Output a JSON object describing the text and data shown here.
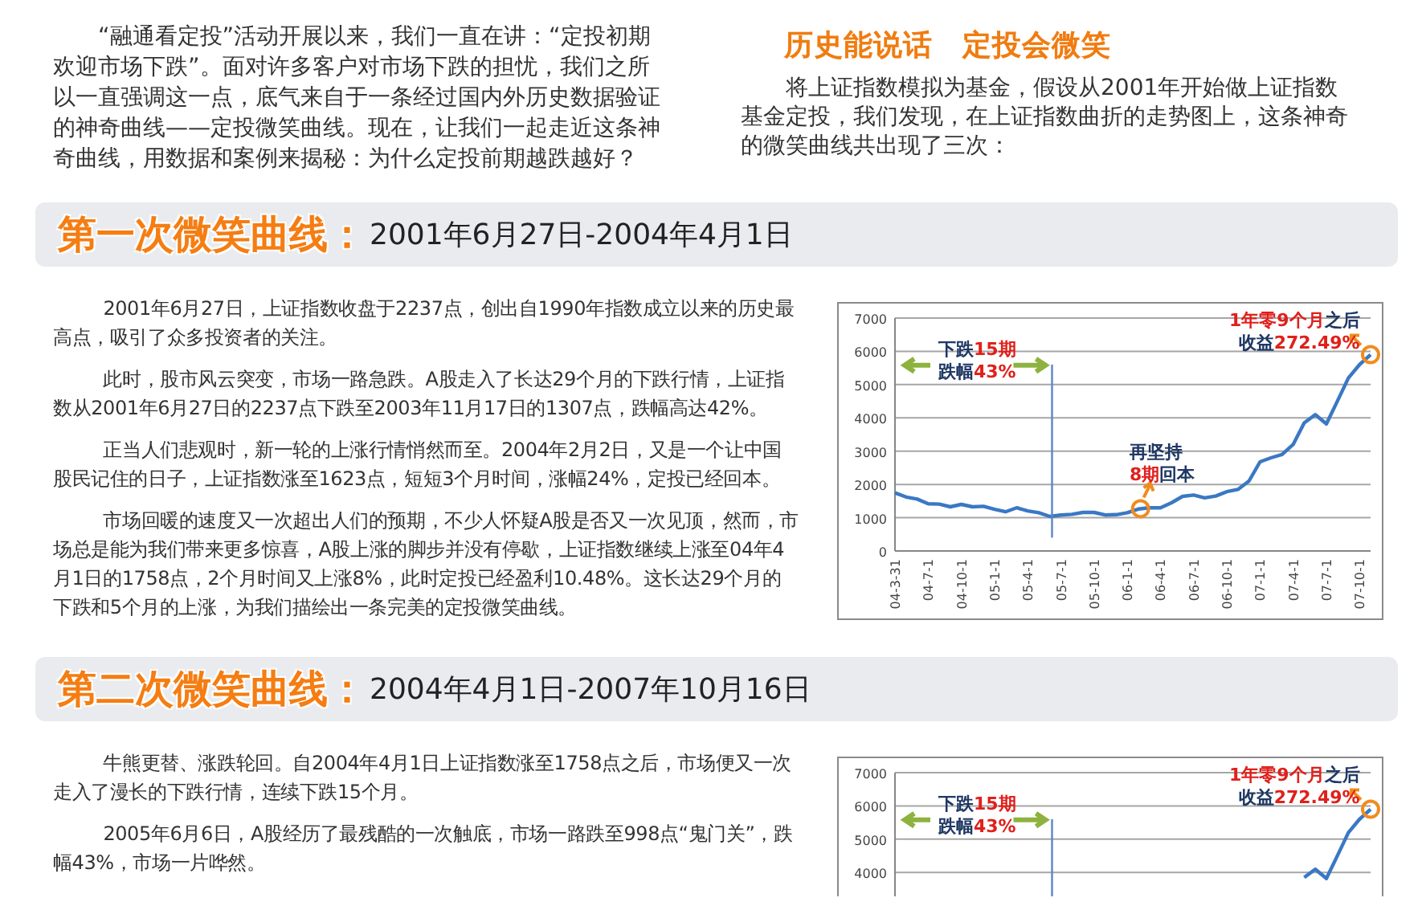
{
  "intro": {
    "paragraph": "“融通看定投”活动开展以来，我们一直在讲：“定投初期欢迎市场下跌”。面对许多客户对市场下跌的担忧，我们之所以一直强调这一点，底气来自于一条经过国内外历史数据验证的神奇曲线——定投微笑曲线。现在，让我们一起走近这条神奇曲线，用数据和案例来揭秘：为什么定投前期越跌越好？"
  },
  "aside": {
    "heading": "历史能说话　定投会微笑",
    "paragraph": "将上证指数模拟为基金，假设从2001年开始做上证指数基金定投，我们发现，在上证指数曲折的走势图上，这条神奇的微笑曲线共出现了三次："
  },
  "sections": [
    {
      "title": "第一次微笑曲线：",
      "date_range": "2001年6月27日-2004年4月1日",
      "paragraphs": [
        "2001年6月27日，上证指数收盘于2237点，创出自1990年指数成立以来的历史最高点，吸引了众多投资者的关注。",
        "此时，股市风云突变，市场一路急跌。A股走入了长达29个月的下跌行情，上证指数从2001年6月27日的2237点下跌至2003年11月17日的1307点，跌幅高达42%。",
        "正当人们悲观时，新一轮的上涨行情悄然而至。2004年2月2日，又是一个让中国股民记住的日子，上证指数涨至1623点，短短3个月时间，涨幅24%，定投已经回本。",
        "市场回暖的速度又一次超出人们的预期，不少人怀疑A股是否又一次见顶，然而，市场总是能为我们带来更多惊喜，A股上涨的脚步并没有停歇，上证指数继续上涨至04年4月1日的1758点，2个月时间又上涨8%，此时定投已经盈利10.48%。这长达29个月的下跌和5个月的上涨，为我们描绘出一条完美的定投微笑曲线。"
      ],
      "chart_data": {
        "type": "line",
        "grid": true,
        "ylim": [
          0,
          7000
        ],
        "yticks": [
          0,
          1000,
          2000,
          3000,
          4000,
          5000,
          6000,
          7000
        ],
        "categories": [
          "04-3-31",
          null,
          null,
          "04-7-1",
          null,
          null,
          "04-10-1",
          null,
          null,
          "05-1-1",
          null,
          null,
          "05-4-1",
          null,
          null,
          "05-7-1",
          null,
          null,
          "05-10-1",
          null,
          null,
          "06-1-1",
          null,
          null,
          "06-4-1",
          null,
          null,
          "06-7-1",
          null,
          null,
          "06-10-1",
          null,
          null,
          "07-1-1",
          null,
          null,
          "07-4-1",
          null,
          null,
          "07-7-1",
          null,
          null,
          "07-10-1",
          null
        ],
        "series": [
          {
            "color": "#3a78c4",
            "values": [
              1750,
              1620,
              1560,
              1420,
              1410,
              1330,
              1400,
              1330,
              1340,
              1250,
              1180,
              1300,
              1200,
              1150,
              1040,
              1080,
              1100,
              1160,
              1160,
              1080,
              1090,
              1150,
              1260,
              1300,
              1300,
              1450,
              1640,
              1680,
              1600,
              1650,
              1780,
              1850,
              2100,
              2680,
              2800,
              2900,
              3200,
              3850,
              4100,
              3820,
              4500,
              5200,
              5600,
              5900
            ]
          }
        ]
      },
      "chart_labels": [
        {
          "kind": "drop",
          "lines": [
            [
              {
                "text": "下跌",
                "highlight": false
              },
              {
                "text": "15期",
                "highlight": true
              }
            ],
            [
              {
                "text": "跌幅",
                "highlight": false
              },
              {
                "text": "43%",
                "highlight": true
              }
            ]
          ]
        },
        {
          "kind": "recovery",
          "lines": [
            [
              {
                "text": "再坚持",
                "highlight": false
              }
            ],
            [
              {
                "text": "8期",
                "highlight": true
              },
              {
                "text": "回本",
                "highlight": false
              }
            ]
          ]
        },
        {
          "kind": "gain",
          "lines": [
            [
              {
                "text": "1年零9个月",
                "highlight": true
              },
              {
                "text": "之后",
                "highlight": false
              }
            ],
            [
              {
                "text": "收益",
                "highlight": false
              },
              {
                "text": "272.49%",
                "highlight": true
              }
            ]
          ]
        }
      ]
    },
    {
      "title": "第二次微笑曲线：",
      "date_range": "2004年4月1日-2007年10月16日",
      "paragraphs": [
        "牛熊更替、涨跌轮回。自2004年4月1日上证指数涨至1758点之后，市场便又一次走入了漫长的下跌行情，连续下跌15个月。",
        "2005年6月6日，A股经历了最残酷的一次触底，市场一路跌至998点“鬼门关”，跌幅43%，市场一片哗然。"
      ],
      "chart_data": {
        "type": "line",
        "grid": true,
        "ylim": [
          0,
          7000
        ],
        "yticks": [
          4000,
          5000,
          6000,
          7000
        ],
        "categories": [
          null,
          null,
          null,
          null,
          null,
          null,
          null,
          null,
          null,
          null,
          null,
          null,
          null,
          null,
          null,
          null,
          null,
          null,
          null,
          null,
          null,
          null,
          null,
          null,
          null,
          null,
          null,
          null,
          null,
          null,
          null,
          null,
          null,
          null,
          null,
          null,
          null,
          null,
          null,
          null,
          null,
          null,
          null,
          null
        ],
        "series": [
          {
            "color": "#3a78c4",
            "values": [
              null,
              null,
              null,
              null,
              null,
              null,
              null,
              null,
              null,
              null,
              null,
              null,
              null,
              null,
              null,
              null,
              null,
              null,
              null,
              null,
              null,
              null,
              null,
              null,
              null,
              null,
              null,
              null,
              null,
              null,
              null,
              null,
              null,
              null,
              null,
              null,
              null,
              3850,
              4100,
              3820,
              4500,
              5200,
              5600,
              5900
            ]
          }
        ]
      },
      "chart_labels": [
        {
          "kind": "drop",
          "lines": [
            [
              {
                "text": "下跌",
                "highlight": false
              },
              {
                "text": "15期",
                "highlight": true
              }
            ],
            [
              {
                "text": "跌幅",
                "highlight": false
              },
              {
                "text": "43%",
                "highlight": true
              }
            ]
          ]
        },
        {
          "kind": "gain",
          "lines": [
            [
              {
                "text": "1年零9个月",
                "highlight": true
              },
              {
                "text": "之后",
                "highlight": false
              }
            ],
            [
              {
                "text": "收益",
                "highlight": false
              },
              {
                "text": "272.49%",
                "highlight": true
              }
            ]
          ]
        }
      ]
    }
  ]
}
